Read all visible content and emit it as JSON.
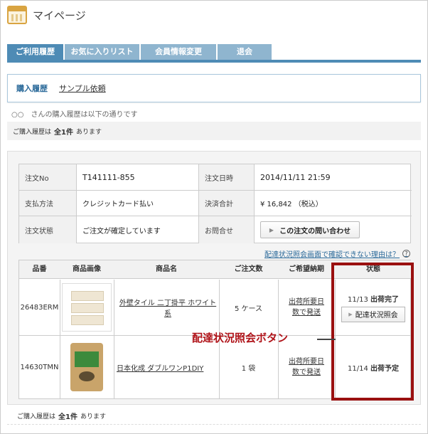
{
  "page": {
    "title": "マイページ"
  },
  "tabs": [
    "ご利用履歴",
    "お気に入りリスト",
    "会員情報変更",
    "退会"
  ],
  "subnav": {
    "active": "購入履歴",
    "link": "サンプル依頼"
  },
  "intro": "○○　さんの購入履歴は以下の通りです",
  "count": {
    "prefix": "ご購入履歴は",
    "value": "全1件",
    "suffix": "あります"
  },
  "order": {
    "labels": [
      "注文No",
      "注文日時",
      "支払方法",
      "決済合計",
      "注文状態",
      "お問合せ"
    ],
    "order_no": "T141111-855",
    "order_date": "2014/11/11  21:59",
    "payment": "クレジットカード払い",
    "total": "¥ 16,842 （税込）",
    "status": "ご注文が確定しています",
    "inquiry_button": "この注文の問い合わせ"
  },
  "note": {
    "text": "配達状況照会画面で確認できない理由は？",
    "icon_text": "?"
  },
  "items_table": {
    "headers": [
      "品番",
      "商品画像",
      "商品名",
      "ご注文数",
      "ご希望納期",
      "状態"
    ],
    "rows": [
      {
        "code": "26483ERM",
        "name": "外壁タイル 二丁掛平 ホワイト系",
        "qty": "5 ケース",
        "delivery": "出荷所要日数で発送",
        "status_date": "11/13",
        "status_word": "出荷完了",
        "track_button": "配達状況照会",
        "image_icon": "tile-product-image"
      },
      {
        "code": "14630TMN",
        "name": "日本化成 ダブルワンP1DIY",
        "qty": "1 袋",
        "delivery": "出荷所要日数で発送",
        "status_date": "11/14",
        "status_word": "出荷予定",
        "image_icon": "bag-product-image"
      }
    ]
  },
  "callout": "配達状況照会ボタン",
  "colors": {
    "tab_active": "#4e8bb5",
    "tab_inactive": "#8fb5cf",
    "highlight": "#9a1010",
    "callout": "#b0141a"
  }
}
